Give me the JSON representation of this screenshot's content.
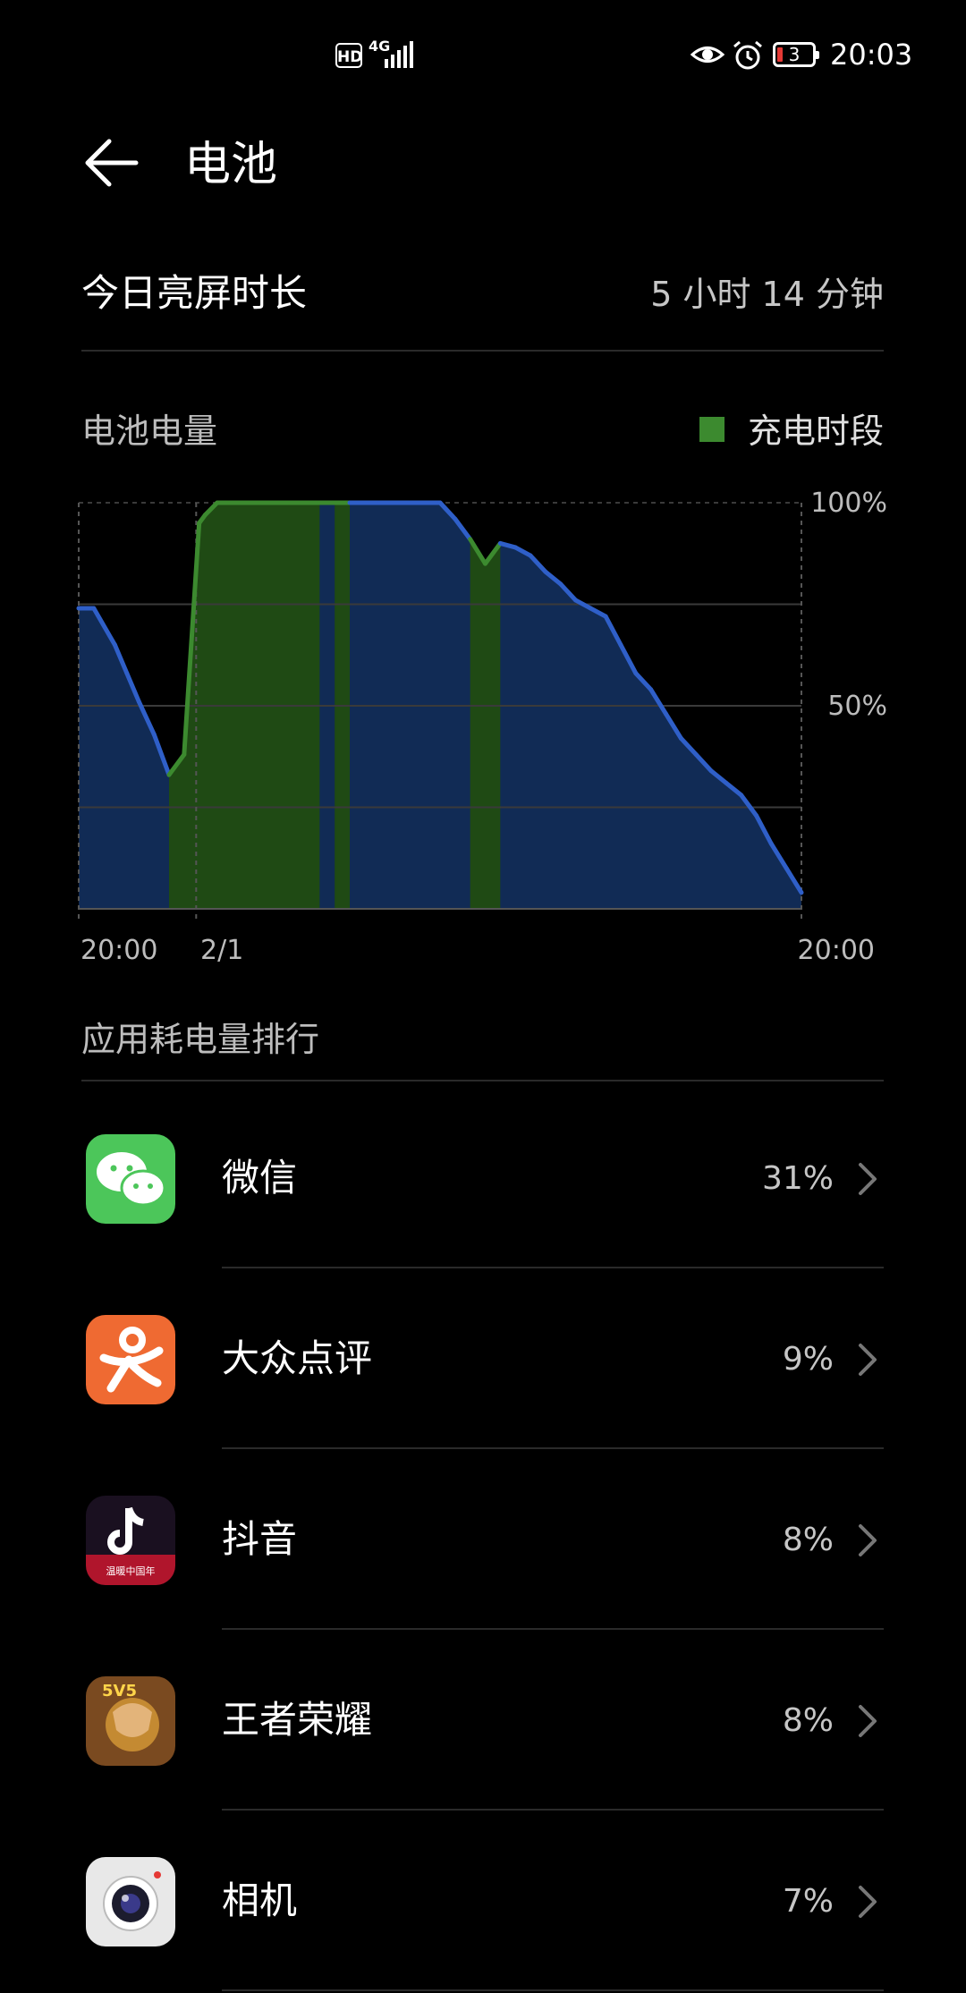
{
  "status_bar": {
    "hd": "HD",
    "network": "4G",
    "battery_level": "3",
    "time": "20:03",
    "icons": [
      "hd-icon",
      "signal-icon",
      "eye-icon",
      "alarm-icon",
      "battery-icon"
    ]
  },
  "header": {
    "title": "电池"
  },
  "screen_time": {
    "label": "今日亮屏时长",
    "value": "5 小时 14 分钟"
  },
  "battery_section": {
    "label": "电池电量",
    "legend_label": "充电时段",
    "legend_color": "#3c8a2f",
    "line_color": "#2f5fc8",
    "fill_color": "#13305e"
  },
  "chart_data": {
    "type": "area",
    "title": "",
    "ylabel": "",
    "xlabel": "",
    "ylim": [
      0,
      100
    ],
    "y_ticks": [
      "100%",
      "50%"
    ],
    "x_tick_labels": [
      "20:00",
      "2/1",
      "20:00"
    ],
    "x_range_hours": [
      0,
      24
    ],
    "x": [
      0,
      0.5,
      1.2,
      1.6,
      2.0,
      2.5,
      3.0,
      3.5,
      4.0,
      4.2,
      4.6,
      5.0,
      6.0,
      7.0,
      8.0,
      9.0,
      10.0,
      11.0,
      12.0,
      12.5,
      13.0,
      13.5,
      14.0,
      14.5,
      15.0,
      15.5,
      16.0,
      16.5,
      17.0,
      17.5,
      18.0,
      18.5,
      19.0,
      19.5,
      20.0,
      20.5,
      21.0,
      21.5,
      22.0,
      22.5,
      23.0,
      23.5,
      24.0
    ],
    "series": [
      {
        "values": [
          74,
          74,
          65,
          58,
          51,
          43,
          33,
          38,
          95,
          97,
          100,
          100,
          100,
          100,
          100,
          100,
          100,
          100,
          100,
          96,
          91,
          85,
          90,
          89,
          87,
          83,
          80,
          76,
          74,
          72,
          65,
          58,
          54,
          48,
          42,
          38,
          34,
          31,
          28,
          23,
          16,
          10,
          4
        ]
      }
    ],
    "charging_periods": [
      [
        3.0,
        8.0
      ],
      [
        8.5,
        9.0
      ],
      [
        13.0,
        14.0
      ]
    ],
    "grid": true,
    "legend": "top-right"
  },
  "ranking": {
    "label": "应用耗电量排行",
    "apps": [
      {
        "name": "微信",
        "percent": "31%",
        "icon": "wechat-icon",
        "color": "#4cc65a"
      },
      {
        "name": "大众点评",
        "percent": "9%",
        "icon": "dianping-icon",
        "color": "#ef6a32"
      },
      {
        "name": "抖音",
        "percent": "8%",
        "icon": "douyin-icon",
        "color": "#b0152c",
        "icon_text": "温暖中国年"
      },
      {
        "name": "王者荣耀",
        "percent": "8%",
        "icon": "honor-of-kings-icon",
        "color": "#c48a32",
        "icon_text": "5V5"
      },
      {
        "name": "相机",
        "percent": "7%",
        "icon": "camera-icon",
        "color": "#e8e8e8"
      }
    ]
  }
}
